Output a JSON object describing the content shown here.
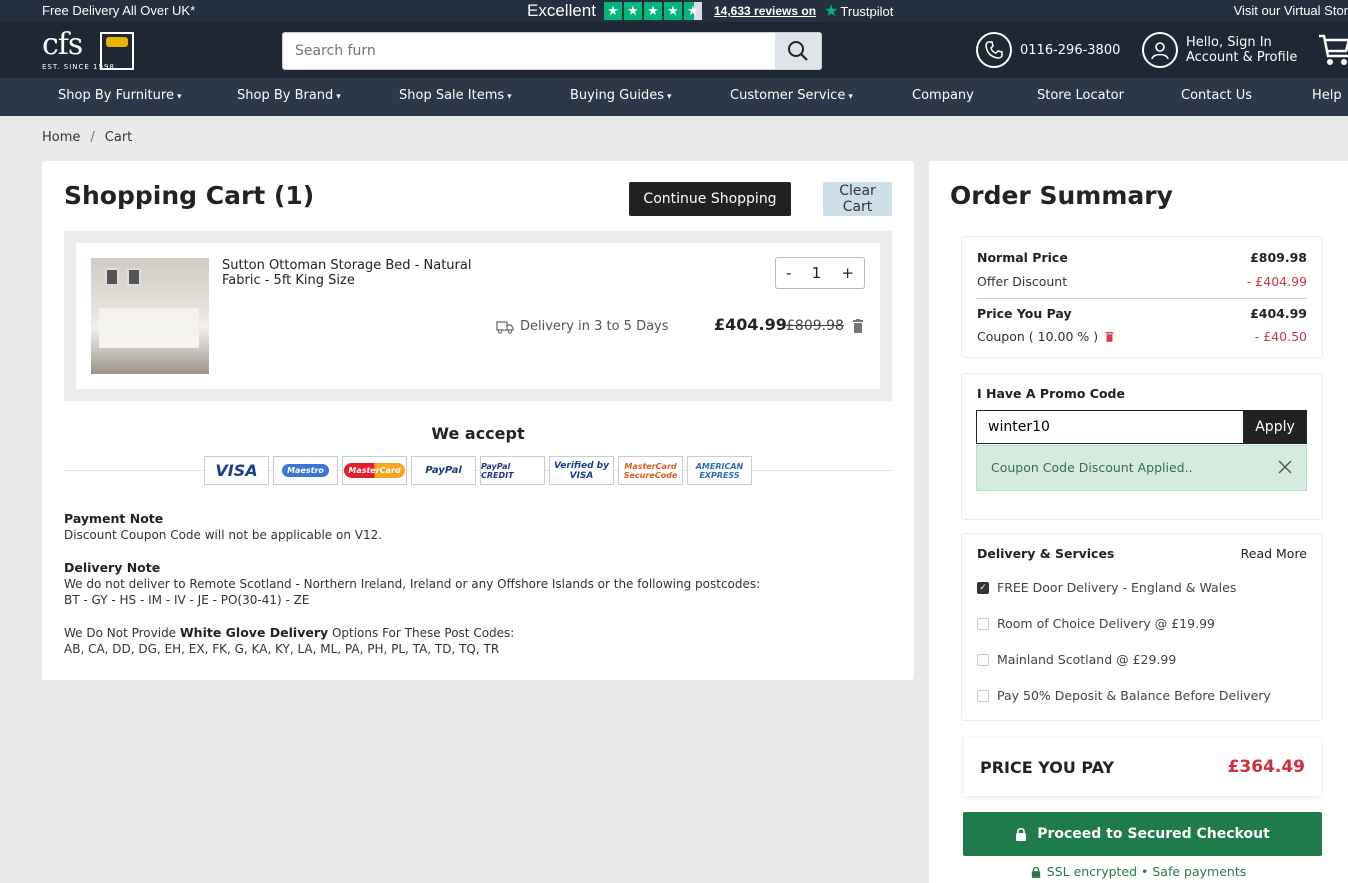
{
  "topbar": {
    "left_text": "Free Delivery All Over UK*",
    "rating_word": "Excellent",
    "reviews": "14,633 reviews on",
    "trustpilot": "Trustpilot",
    "right_text": "Visit our Virtual Stor"
  },
  "header": {
    "logo_text": "cfs",
    "logo_est": "EST. SINCE 1998",
    "search_placeholder": "Search furn",
    "phone": "0116-296-3800",
    "account_line1": "Hello, Sign In",
    "account_line2": "Account & Profile"
  },
  "nav": [
    {
      "label": "Shop By Furniture"
    },
    {
      "label": "Shop By Brand"
    },
    {
      "label": "Shop Sale Items"
    },
    {
      "label": "Buying Guides"
    },
    {
      "label": "Customer Service"
    },
    {
      "label": "Company"
    },
    {
      "label": "Store Locator"
    },
    {
      "label": "Contact Us"
    },
    {
      "label": "Help"
    }
  ],
  "breadcrumb": {
    "home": "Home",
    "sep": "/",
    "current": "Cart"
  },
  "cart": {
    "title": "Shopping Cart (1)",
    "continue_label": "Continue Shopping",
    "clear_label": "Clear Cart",
    "item": {
      "name": "Sutton Ottoman Storage Bed - Natural Fabric - 5ft King Size",
      "qty": "1",
      "minus": "-",
      "plus": "+",
      "delivery": "Delivery in 3 to 5 Days",
      "price": "£404.99",
      "was_price": "£809.98"
    },
    "we_accept": "We accept",
    "cards": [
      "VISA",
      "Maestro",
      "MasterCard",
      "PayPal",
      "PayPal CREDIT",
      "Verified by VISA",
      "MasterCard SecureCode",
      "AMERICAN EXPRESS"
    ],
    "payment_note_title": "Payment Note",
    "payment_note": "Discount Coupon Code will not be applicable on V12.",
    "delivery_note_title": "Delivery Note",
    "delivery_note_1": "We do not deliver to Remote Scotland - Northern Ireland, Ireland or any Offshore Islands or the following postcodes:",
    "delivery_note_2": "BT - GY - HS - IM - IV - JE - PO(30-41) - ZE",
    "white_glove_pre": "We Do Not Provide ",
    "white_glove_bold": "White Glove Delivery",
    "white_glove_post": " Options For These Post Codes:",
    "white_glove_codes": "AB, CA, DD, DG, EH, EX, FK, G, KA, KY, LA, ML, PA, PH, PL, TA, TD, TQ, TR"
  },
  "summary": {
    "title": "Order Summary",
    "normal_price_label": "Normal Price",
    "normal_price": "£809.98",
    "offer_label": "Offer Discount",
    "offer_value": "- £404.99",
    "pay_label": "Price You Pay",
    "pay_value": "£404.99",
    "coupon_label": "Coupon ( 10.00 % )",
    "coupon_value": "- £40.50",
    "promo_title": "I Have A Promo Code",
    "promo_value": "winter10",
    "apply_label": "Apply",
    "alert_text": "Coupon Code Discount Applied..",
    "delivery_title": "Delivery & Services",
    "read_more": "Read More",
    "options": [
      {
        "label": "FREE Door Delivery - England & Wales",
        "checked": true
      },
      {
        "label": "Room of Choice Delivery @ £19.99",
        "checked": false
      },
      {
        "label": "Mainland Scotland @ £29.99",
        "checked": false
      },
      {
        "label": "Pay 50% Deposit & Balance Before Delivery",
        "checked": false
      }
    ],
    "total_label": "PRICE YOU PAY",
    "total_value": "£364.49",
    "checkout_label": "Proceed to Secured Checkout",
    "ssl_text": "SSL encrypted • Safe payments"
  },
  "colors": {
    "accent_green": "#1f7a4c",
    "price_red": "#d02c3c",
    "header_bg": "#1e2835"
  }
}
